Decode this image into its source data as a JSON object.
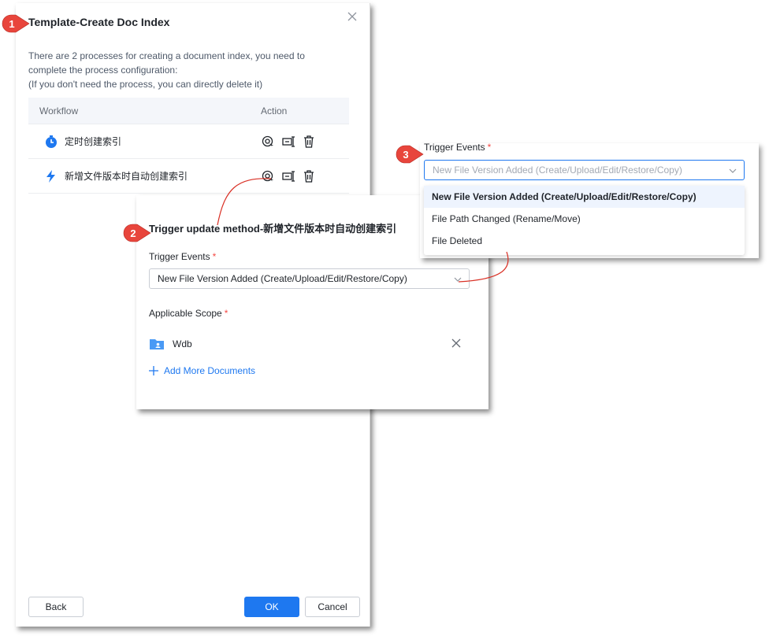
{
  "main_dialog": {
    "title": "Template-Create Doc Index",
    "description_lines": [
      "There are 2 processes for creating a document index, you need to",
      "complete the process configuration:",
      "(If you don't need the process, you can directly delete it)"
    ],
    "table": {
      "headers": [
        "Workflow",
        "Action"
      ],
      "rows": [
        {
          "name": "定时创建索引",
          "icon": "clock-icon"
        },
        {
          "name": "新增文件版本时自动创建索引",
          "icon": "lightning-icon"
        }
      ]
    },
    "back_label": "Back",
    "ok_label": "OK",
    "cancel_label": "Cancel"
  },
  "trigger_panel": {
    "title": "Trigger update method-新增文件版本时自动创建索引",
    "trigger_events_label": "Trigger Events",
    "trigger_events_value": "New File Version Added (Create/Upload/Edit/Restore/Copy)",
    "scope_label": "Applicable Scope",
    "scope_item": "Wdb",
    "add_more_label": "Add More Documents"
  },
  "dropdown_panel": {
    "label": "Trigger Events",
    "placeholder": "New File Version Added (Create/Upload/Edit/Restore/Copy)",
    "options": [
      "New File Version Added (Create/Upload/Edit/Restore/Copy)",
      "File Path Changed (Rename/Move)",
      "File Deleted"
    ],
    "selected_index": 0
  },
  "required_mark": "*",
  "steps": [
    "1",
    "2",
    "3"
  ],
  "colors": {
    "primary": "#1e78f0",
    "badge": "#e8453c",
    "required": "#f54a45",
    "connector": "#d93025"
  }
}
